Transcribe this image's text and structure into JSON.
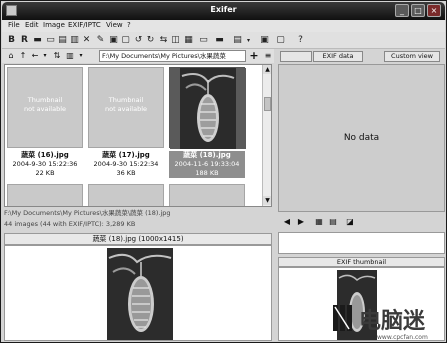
{
  "window": {
    "title": "Exifer",
    "minimize_label": "_",
    "maximize_label": "□",
    "close_label": "×"
  },
  "menu": [
    "File",
    "Edit",
    "Image",
    "EXIF/IPTC",
    "View",
    "?"
  ],
  "path": {
    "value": "F:\\My Documents\\My Pictures\\水果蔬菜"
  },
  "thumbnails": [
    {
      "placeholder_line1": "Thumbnail",
      "placeholder_line2": "not available",
      "name": "蔬菜 (16).jpg",
      "date": "2004-9-30 15:22:36",
      "size": "22 KB"
    },
    {
      "placeholder_line1": "Thumbnail",
      "placeholder_line2": "not available",
      "name": "蔬菜 (17).jpg",
      "date": "2004-9-30 15:22:34",
      "size": "36 KB"
    },
    {
      "name": "蔬菜 (18).jpg",
      "date": "2004-11-6 19:33:04",
      "size": "188 KB"
    }
  ],
  "status": {
    "file_path": "F:\\My Documents\\My Pictures\\水果蔬菜\\蔬菜 (18).jpg",
    "count_text": "44 images (44 with EXIF/IPTC): 3,289 KB"
  },
  "preview": {
    "header": "蔬菜 (18).jpg (1000x1415)"
  },
  "right_panel": {
    "tabs": [
      "EXIF data",
      "Custom view"
    ],
    "no_data": "No data",
    "exif_thumb_header": "EXIF thumbnail"
  },
  "watermark": {
    "text": "电脑迷",
    "url": "www.cpcfan.com"
  },
  "colors": {
    "titlebar": "#1a1a1a",
    "selection": "#8e8e8e",
    "panel": "#cdcdcd"
  }
}
